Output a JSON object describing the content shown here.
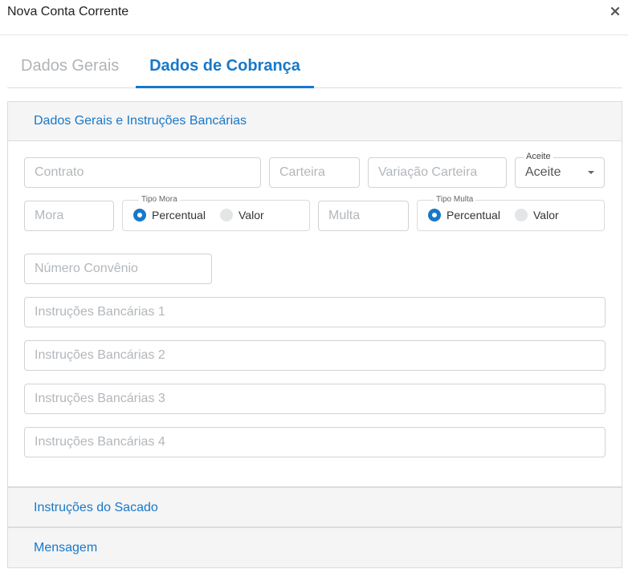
{
  "dialog": {
    "title": "Nova Conta Corrente",
    "close_icon": "close-icon"
  },
  "tabs": [
    {
      "label": "Dados Gerais",
      "active": false
    },
    {
      "label": "Dados de Cobrança",
      "active": true
    }
  ],
  "accent_color": "#1878c8",
  "sections": {
    "main": {
      "title": "Dados Gerais e Instruções Bancárias"
    },
    "sacado": {
      "title": "Instruções do Sacado"
    },
    "mensagem": {
      "title": "Mensagem"
    }
  },
  "form": {
    "contrato": {
      "placeholder": "Contrato",
      "value": ""
    },
    "carteira": {
      "placeholder": "Carteira",
      "value": ""
    },
    "variacao_carteira": {
      "placeholder": "Variação Carteira",
      "value": ""
    },
    "aceite": {
      "label": "Aceite",
      "value": "Aceite"
    },
    "mora": {
      "placeholder": "Mora",
      "value": ""
    },
    "tipo_mora": {
      "label": "Tipo Mora",
      "options": [
        {
          "label": "Percentual",
          "selected": true
        },
        {
          "label": "Valor",
          "selected": false
        }
      ]
    },
    "multa": {
      "placeholder": "Multa",
      "value": ""
    },
    "tipo_multa": {
      "label": "Tipo Multa",
      "options": [
        {
          "label": "Percentual",
          "selected": true
        },
        {
          "label": "Valor",
          "selected": false
        }
      ]
    },
    "numero_convenio": {
      "placeholder": "Número Convênio",
      "value": ""
    },
    "instrucoes": [
      {
        "placeholder": "Instruções Bancárias 1",
        "value": ""
      },
      {
        "placeholder": "Instruções Bancárias 2",
        "value": ""
      },
      {
        "placeholder": "Instruções Bancárias 3",
        "value": ""
      },
      {
        "placeholder": "Instruções Bancárias 4",
        "value": ""
      }
    ]
  }
}
